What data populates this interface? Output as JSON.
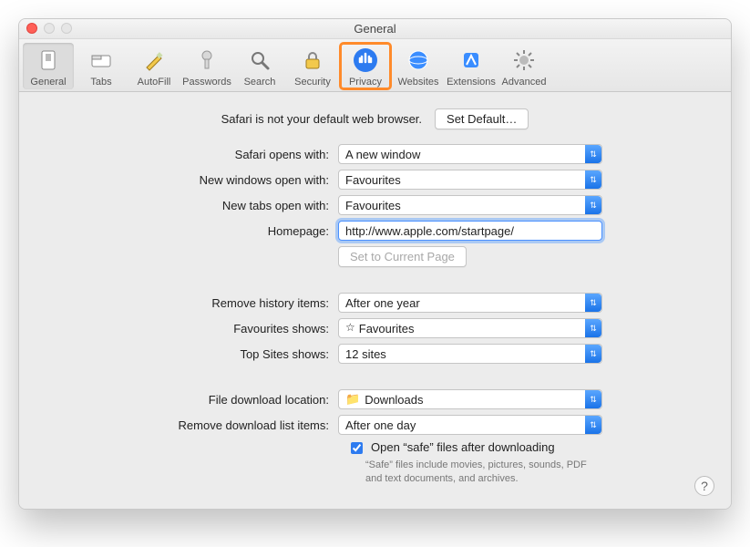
{
  "window": {
    "title": "General"
  },
  "toolbar": {
    "items": [
      {
        "label": "General",
        "icon": "general-icon",
        "active": true
      },
      {
        "label": "Tabs",
        "icon": "tabs-icon"
      },
      {
        "label": "AutoFill",
        "icon": "autofill-icon"
      },
      {
        "label": "Passwords",
        "icon": "passwords-icon"
      },
      {
        "label": "Search",
        "icon": "search-icon"
      },
      {
        "label": "Security",
        "icon": "security-icon"
      },
      {
        "label": "Privacy",
        "icon": "privacy-icon",
        "highlight": true
      },
      {
        "label": "Websites",
        "icon": "websites-icon"
      },
      {
        "label": "Extensions",
        "icon": "extensions-icon"
      },
      {
        "label": "Advanced",
        "icon": "advanced-icon"
      }
    ]
  },
  "default_browser": {
    "message": "Safari is not your default web browser.",
    "button": "Set Default…"
  },
  "form": {
    "opens_with": {
      "label": "Safari opens with:",
      "value": "A new window"
    },
    "new_windows": {
      "label": "New windows open with:",
      "value": "Favourites"
    },
    "new_tabs": {
      "label": "New tabs open with:",
      "value": "Favourites"
    },
    "homepage": {
      "label": "Homepage:",
      "value": "http://www.apple.com/startpage/"
    },
    "set_current": {
      "label": "Set to Current Page"
    },
    "remove_history": {
      "label": "Remove history items:",
      "value": "After one year"
    },
    "favourites_shows": {
      "label": "Favourites shows:",
      "value": "Favourites"
    },
    "top_sites": {
      "label": "Top Sites shows:",
      "value": "12 sites"
    },
    "download_loc": {
      "label": "File download location:",
      "value": "Downloads"
    },
    "remove_dl": {
      "label": "Remove download list items:",
      "value": "After one day"
    },
    "open_safe": {
      "label": "Open “safe” files after downloading",
      "note": "“Safe” files include movies, pictures, sounds, PDF and text documents, and archives."
    }
  }
}
